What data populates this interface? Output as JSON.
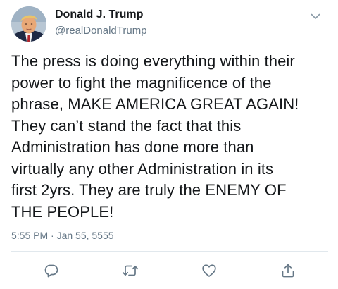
{
  "tweet": {
    "display_name": "Donald J. Trump",
    "handle": "@realDonaldTrump",
    "text_lines": [
      "The press is doing everything within their",
      "power to fight the magnificence of the",
      "phrase, MAKE AMERICA GREAT AGAIN!",
      "They can’t stand the fact that this",
      "Administration has done more than",
      "virtually any other Administration in its",
      "first 2yrs. They are truly the ENEMY OF",
      "THE PEOPLE!"
    ],
    "timestamp": "5:55 PM · Jan 55, 5555"
  },
  "actions": {
    "reply_icon": "reply-icon",
    "retweet_icon": "retweet-icon",
    "like_icon": "heart-icon",
    "share_icon": "share-icon"
  },
  "colors": {
    "text": "#14171a",
    "secondary": "#657786",
    "divider": "#e1e8ed",
    "icon": "#657786"
  }
}
